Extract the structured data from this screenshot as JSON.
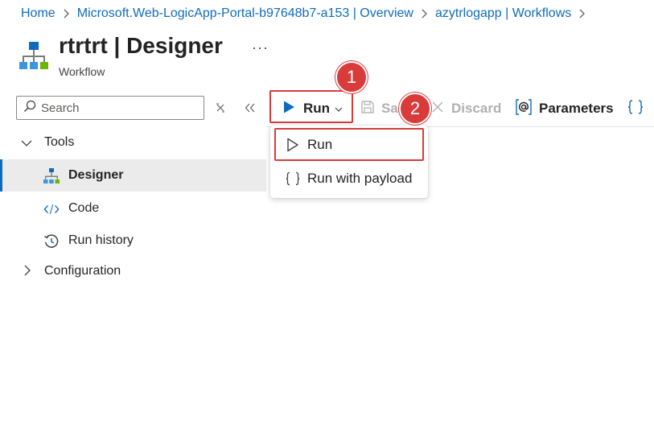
{
  "breadcrumb": {
    "items": [
      {
        "label": "Home"
      },
      {
        "label": "Microsoft.Web-LogicApp-Portal-b97648b7-a153 | Overview"
      },
      {
        "label": "azytrlogapp | Workflows"
      }
    ]
  },
  "header": {
    "title_name": "rtrtrt",
    "title_separator": " | ",
    "title_page": "Designer",
    "subtitle": "Workflow",
    "more_label": "···"
  },
  "search": {
    "placeholder": "Search",
    "value": ""
  },
  "sidebar": {
    "groups": [
      {
        "label": "Tools",
        "expanded": true,
        "items": [
          {
            "label": "Designer",
            "icon": "workflow-icon",
            "selected": true
          },
          {
            "label": "Code",
            "icon": "code-icon",
            "selected": false
          },
          {
            "label": "Run history",
            "icon": "history-icon",
            "selected": false
          }
        ]
      },
      {
        "label": "Configuration",
        "expanded": false,
        "items": []
      }
    ]
  },
  "toolbar": {
    "run_label": "Run",
    "save_label": "Sa",
    "discard_label": "Discard",
    "parameters_label": "Parameters"
  },
  "run_menu": {
    "items": [
      {
        "label": "Run",
        "icon": "play-outline-icon"
      },
      {
        "label": "Run with payload",
        "icon": "braces-icon"
      }
    ]
  },
  "callouts": [
    {
      "number": "1"
    },
    {
      "number": "2"
    }
  ],
  "colors": {
    "accent": "#0f6cbd",
    "callout": "#d93b3b",
    "selected_bg": "#ebebeb"
  }
}
